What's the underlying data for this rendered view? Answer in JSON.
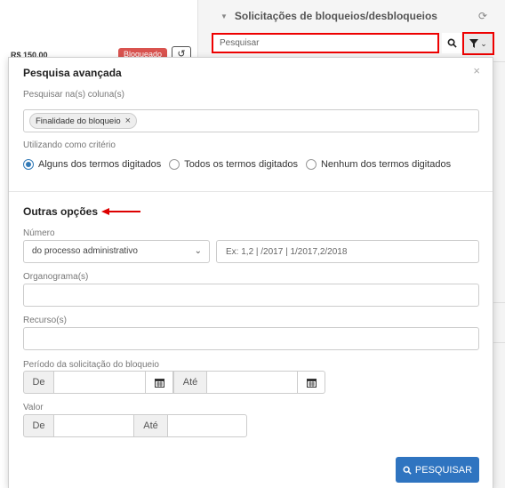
{
  "background": {
    "price": "R$ 150,00",
    "badge": "Bloqueado"
  },
  "panel": {
    "title": "Solicitações de bloqueios/desbloqueios",
    "search_placeholder": "Pesquisar"
  },
  "advanced": {
    "title": "Pesquisa avançada",
    "columns_label": "Pesquisar na(s) coluna(s)",
    "column_chip": "Finalidade do bloqueio",
    "criteria_label": "Utilizando como critério",
    "criteria_options": [
      {
        "label": "Alguns dos termos digitados",
        "selected": true
      },
      {
        "label": "Todos os termos digitados",
        "selected": false
      },
      {
        "label": "Nenhum dos termos digitados",
        "selected": false
      }
    ]
  },
  "other": {
    "title": "Outras opções",
    "numero_label": "Número",
    "numero_select": "do processo administrativo",
    "numero_placeholder": "Ex: 1,2 | /2017 | 1/2017,2/2018",
    "organograma_label": "Organograma(s)",
    "recurso_label": "Recurso(s)",
    "periodo_label": "Período da solicitação do bloqueio",
    "de_label": "De",
    "ate_label": "Até",
    "valor_label": "Valor"
  },
  "submit_label": "PESQUISAR",
  "colors": {
    "primary": "#2f74c0",
    "highlight": "#ee0000",
    "badge": "#d9534f"
  }
}
